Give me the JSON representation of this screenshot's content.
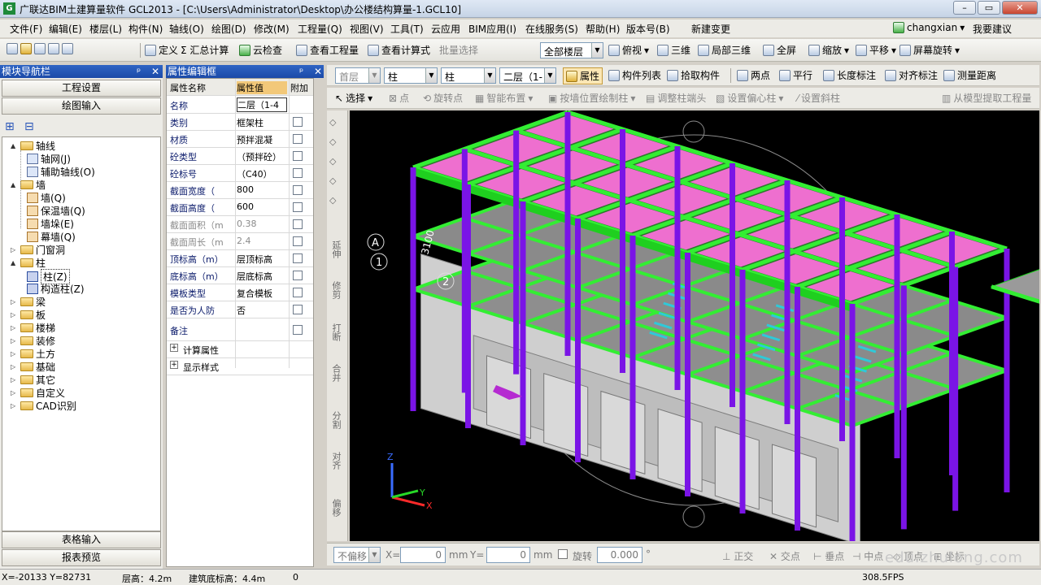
{
  "window": {
    "title": "广联达BIM土建算量软件 GCL2013 - [C:\\Users\\Administrator\\Desktop\\办公楼结构算量-1.GCL10]",
    "min": "–",
    "max": "▭",
    "close": "✕"
  },
  "menu": {
    "items": [
      "文件(F)",
      "编辑(E)",
      "楼层(L)",
      "构件(N)",
      "轴线(O)",
      "绘图(D)",
      "修改(M)",
      "工程量(Q)",
      "视图(V)",
      "工具(T)",
      "云应用",
      "BIM应用(I)",
      "在线服务(S)",
      "帮助(H)",
      "版本号(B)",
      "新建变更"
    ],
    "user": "changxian",
    "feedback": "我要建议"
  },
  "toolbar1": {
    "define": "定义",
    "sum": "Σ 汇总计算",
    "cloud_check": "云检查",
    "view_qty": "查看工程量",
    "view_formula": "查看计算式",
    "batch_select": "批量选择",
    "floor_combo": "全部楼层",
    "top_view": "俯视",
    "three_d": "三维",
    "partial_3d": "局部三维",
    "full_screen": "全屏",
    "zoom": "缩放",
    "pan": "平移",
    "rotate": "屏幕旋转"
  },
  "toolbar2": {
    "layer_combo": "首层",
    "type_combo": "柱",
    "type_combo2": "柱",
    "floor_combo": "二层（1-",
    "props_btn": "属性",
    "comp_list": "构件列表",
    "pick": "拾取构件",
    "two_points": "两点",
    "parallel": "平行",
    "length_dim": "长度标注",
    "angle_dim": "对齐标注",
    "measure": "测量距离"
  },
  "toolbar3": {
    "select": "选择",
    "point": "点",
    "rotate_pt": "旋转点",
    "smart_layout": "智能布置",
    "by_wall": "按墙位置绘制柱",
    "adjust_head": "调整柱端头",
    "set_offset": "设置偏心柱",
    "set_slant": "设置斜柱",
    "extract": "从模型提取工程量"
  },
  "nav": {
    "header": "模块导航栏",
    "project_settings": "工程设置",
    "drawing_input": "绘图输入",
    "table_input": "表格输入",
    "report_preview": "报表预览",
    "tree": [
      {
        "label": "轴线",
        "level": 0,
        "kind": "folder",
        "exp": "▲"
      },
      {
        "label": "轴网(J)",
        "level": 1,
        "kind": "item"
      },
      {
        "label": "辅助轴线(O)",
        "level": 1,
        "kind": "item"
      },
      {
        "label": "墙",
        "level": 0,
        "kind": "folder",
        "exp": "▲"
      },
      {
        "label": "墙(Q)",
        "level": 1,
        "kind": "wall"
      },
      {
        "label": "保温墙(Q)",
        "level": 1,
        "kind": "wall"
      },
      {
        "label": "墙垛(E)",
        "level": 1,
        "kind": "wall"
      },
      {
        "label": "幕墙(Q)",
        "level": 1,
        "kind": "wall"
      },
      {
        "label": "门窗洞",
        "level": 0,
        "kind": "folder",
        "exp": "▷"
      },
      {
        "label": "柱",
        "level": 0,
        "kind": "folder",
        "exp": "▲"
      },
      {
        "label": "柱(Z)",
        "level": 1,
        "kind": "col"
      },
      {
        "label": "构造柱(Z)",
        "level": 1,
        "kind": "col"
      },
      {
        "label": "梁",
        "level": 0,
        "kind": "folder",
        "exp": "▷"
      },
      {
        "label": "板",
        "level": 0,
        "kind": "folder",
        "exp": "▷"
      },
      {
        "label": "楼梯",
        "level": 0,
        "kind": "folder",
        "exp": "▷"
      },
      {
        "label": "装修",
        "level": 0,
        "kind": "folder",
        "exp": "▷"
      },
      {
        "label": "土方",
        "level": 0,
        "kind": "folder",
        "exp": "▷"
      },
      {
        "label": "基础",
        "level": 0,
        "kind": "folder",
        "exp": "▷"
      },
      {
        "label": "其它",
        "level": 0,
        "kind": "folder",
        "exp": "▷"
      },
      {
        "label": "自定义",
        "level": 0,
        "kind": "folder",
        "exp": "▷"
      },
      {
        "label": "CAD识别",
        "level": 0,
        "kind": "folder",
        "exp": "▷"
      }
    ]
  },
  "props": {
    "header": "属性编辑框",
    "col_name": "属性名称",
    "col_value": "属性值",
    "col_extra": "附加",
    "rows": [
      {
        "name": "名称",
        "value": "二层（1-4",
        "dim": false,
        "cb": false
      },
      {
        "name": "类别",
        "value": "框架柱",
        "dim": false,
        "cb": true
      },
      {
        "name": "材质",
        "value": "预拌混凝",
        "dim": false,
        "cb": true
      },
      {
        "name": "砼类型",
        "value": "（预拌砼）",
        "dim": false,
        "cb": true
      },
      {
        "name": "砼标号",
        "value": "（C40）",
        "dim": false,
        "cb": true
      },
      {
        "name": "截面宽度（",
        "value": "800",
        "dim": false,
        "cb": true
      },
      {
        "name": "截面高度（",
        "value": "600",
        "dim": false,
        "cb": true
      },
      {
        "name": "截面面积（m",
        "value": "0.38",
        "dim": true,
        "cb": true
      },
      {
        "name": "截面周长（m",
        "value": "2.4",
        "dim": true,
        "cb": true
      },
      {
        "name": "顶标高（m）",
        "value": "层顶标高",
        "dim": false,
        "cb": true
      },
      {
        "name": "底标高（m）",
        "value": "层底标高",
        "dim": false,
        "cb": true
      },
      {
        "name": "模板类型",
        "value": "复合模板",
        "dim": false,
        "cb": true
      },
      {
        "name": "是否为人防",
        "value": "否",
        "dim": false,
        "cb": true
      },
      {
        "name": "备注",
        "value": "",
        "dim": false,
        "cb": true
      }
    ],
    "calc_attr": "计算属性",
    "display_style": "显示样式"
  },
  "viewport": {
    "axis_A": "A",
    "axis_1": "1",
    "axis_2": "2",
    "dim_label": "3100",
    "gizmo_x": "X",
    "gizmo_y": "Y",
    "gizmo_z": "Z"
  },
  "left_tools": [
    "延伸",
    "修剪",
    "打断",
    "合并",
    "分割",
    "对齐",
    "偏移"
  ],
  "bottom": {
    "offset_combo": "不偏移",
    "x_label": "X=",
    "x_value": "0",
    "mm1": "mm",
    "y_label": "Y=",
    "y_value": "0",
    "mm2": "mm",
    "rotate_label": "旋转",
    "rotate_value": "0.000",
    "deg": "°",
    "snap": [
      "正交",
      "交点",
      "垂点",
      "中点",
      "顶点",
      "坐标"
    ]
  },
  "status": {
    "coords": "X=-20133 Y=82731",
    "floor_height": "层高：4.2m",
    "bottom_elev": "建筑底标高：4.4m",
    "zero": "0",
    "fps": "308.5FPS"
  },
  "watermark": "edu.zhulong.com",
  "colors": {
    "beam": "#33ee33",
    "column": "#7a14e6",
    "slab_top": "#ee6fcf",
    "slab": "#8e8e8e",
    "wall": "#bdbdbd",
    "stair": "#2fc9d8"
  }
}
